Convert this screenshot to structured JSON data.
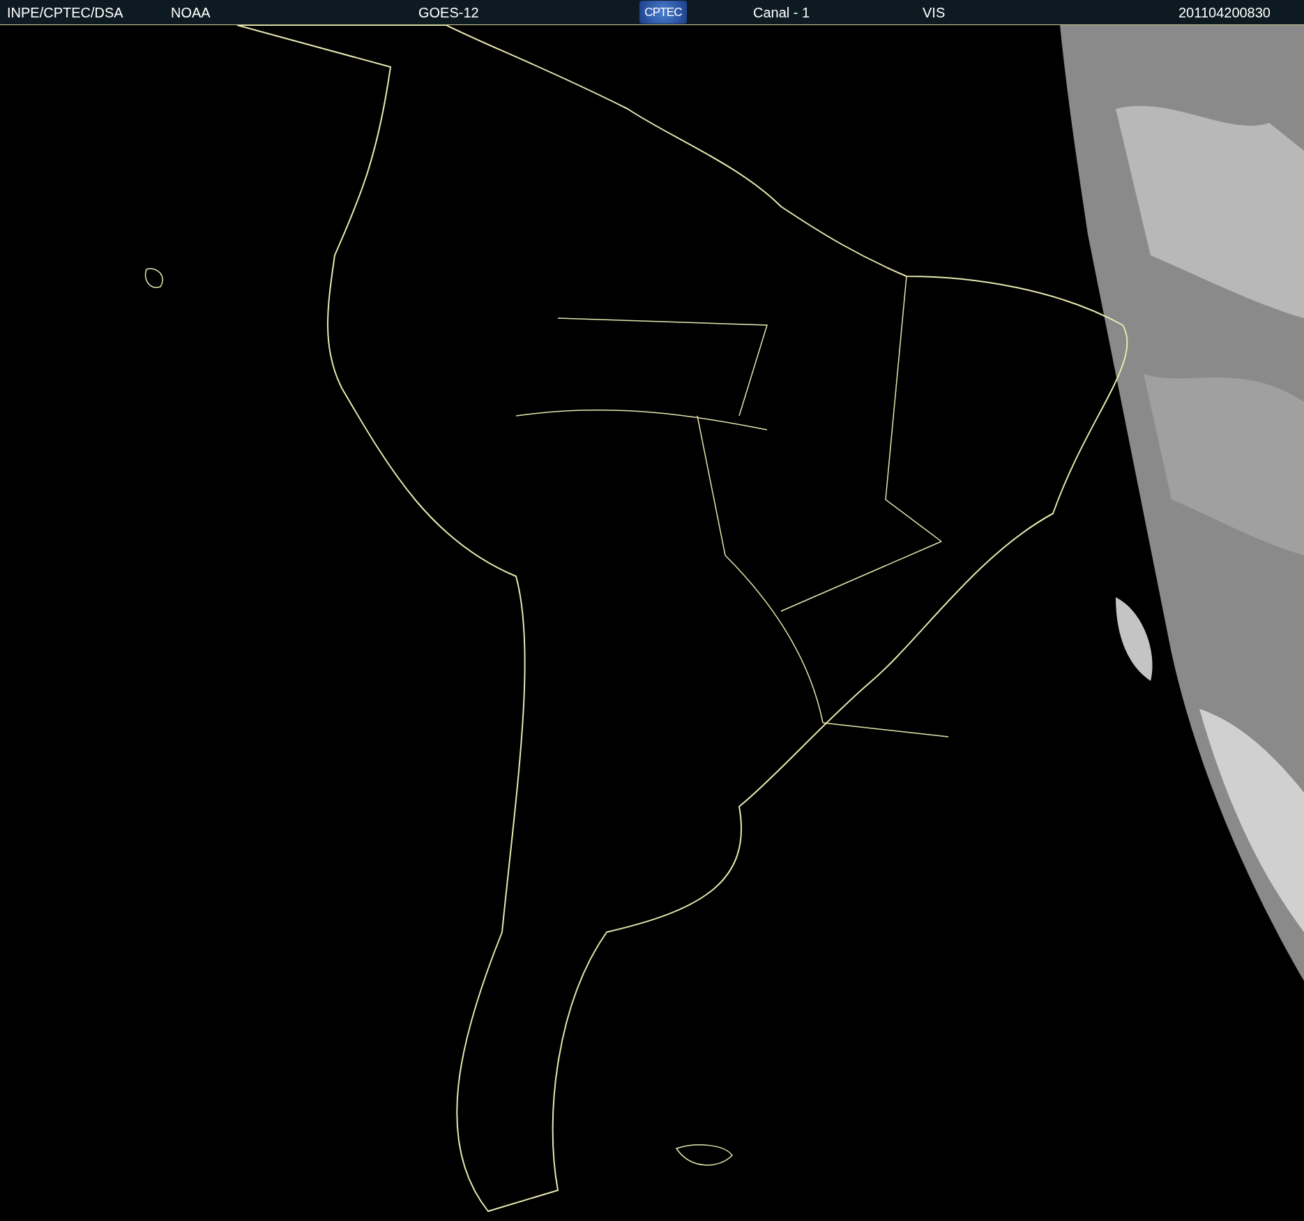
{
  "header": {
    "items": [
      {
        "kind": "text",
        "text": "INPE/CPTEC/DSA"
      },
      {
        "kind": "text",
        "text": "NOAA"
      },
      {
        "kind": "text",
        "text": "GOES-12"
      },
      {
        "kind": "logo",
        "text": "CPTEC"
      },
      {
        "kind": "text",
        "text": "Canal - 1"
      },
      {
        "kind": "text",
        "text": "VIS"
      },
      {
        "kind": "text",
        "text": "201104200830"
      }
    ]
  }
}
